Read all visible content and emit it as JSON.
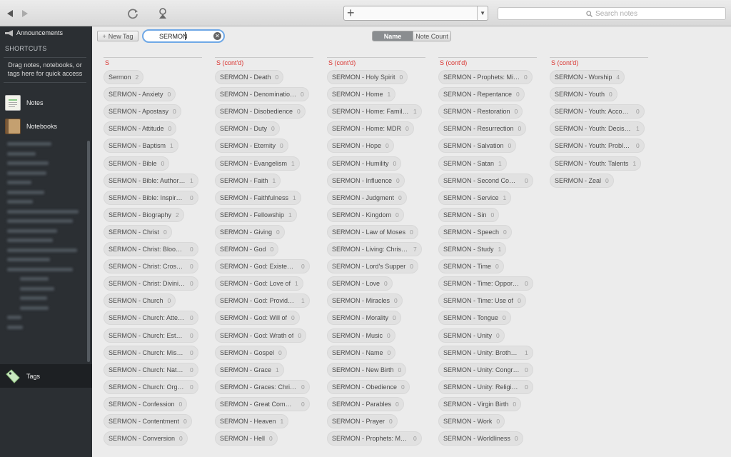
{
  "toolbar": {
    "search_placeholder": "Search notes",
    "new_note_icon": "plus-icon"
  },
  "sidebar": {
    "announcements": "Announcements",
    "shortcuts": "SHORTCUTS",
    "shortcuts_hint": "Drag notes, notebooks, or tags here for quick access",
    "notes": "Notes",
    "notebooks": "Notebooks",
    "tags": "Tags"
  },
  "tags_view": {
    "new_tag_label": "New Tag",
    "filter_value": "SERMON",
    "sort_name": "Name",
    "sort_count": "Note Count",
    "columns": [
      {
        "header": "S",
        "tags": [
          {
            "name": "Sermon",
            "count": "2"
          },
          {
            "name": "SERMON - Anxiety",
            "count": "0"
          },
          {
            "name": "SERMON - Apostasy",
            "count": "0"
          },
          {
            "name": "SERMON - Attitude",
            "count": "0"
          },
          {
            "name": "SERMON - Baptism",
            "count": "1"
          },
          {
            "name": "SERMON - Bible",
            "count": "0"
          },
          {
            "name": "SERMON - Bible: Authori…",
            "count": "1"
          },
          {
            "name": "SERMON - Bible: Inspira…",
            "count": "0"
          },
          {
            "name": "SERMON - Biography",
            "count": "2"
          },
          {
            "name": "SERMON - Christ",
            "count": "0"
          },
          {
            "name": "SERMON - Christ: Blood of",
            "count": "0"
          },
          {
            "name": "SERMON - Christ: Cross of",
            "count": "0"
          },
          {
            "name": "SERMON - Christ: Divinit…",
            "count": "0"
          },
          {
            "name": "SERMON - Church",
            "count": "0"
          },
          {
            "name": "SERMON - Church: Atten…",
            "count": "0"
          },
          {
            "name": "SERMON - Church: Esta…",
            "count": "0"
          },
          {
            "name": "SERMON - Church: Missi…",
            "count": "0"
          },
          {
            "name": "SERMON - Church: Natu…",
            "count": "0"
          },
          {
            "name": "SERMON - Church: Orga…",
            "count": "0"
          },
          {
            "name": "SERMON - Confession",
            "count": "0"
          },
          {
            "name": "SERMON - Contentment",
            "count": "0"
          },
          {
            "name": "SERMON - Conversion",
            "count": "0"
          }
        ]
      },
      {
        "header": "S (cont'd)",
        "tags": [
          {
            "name": "SERMON - Death",
            "count": "0"
          },
          {
            "name": "SERMON - Denominatio…",
            "count": "0"
          },
          {
            "name": "SERMON - Disobedience",
            "count": "0"
          },
          {
            "name": "SERMON - Duty",
            "count": "0"
          },
          {
            "name": "SERMON - Eternity",
            "count": "0"
          },
          {
            "name": "SERMON - Evangelism",
            "count": "1"
          },
          {
            "name": "SERMON - Faith",
            "count": "1"
          },
          {
            "name": "SERMON - Faithfulness",
            "count": "1"
          },
          {
            "name": "SERMON - Fellowship",
            "count": "1"
          },
          {
            "name": "SERMON - Giving",
            "count": "0"
          },
          {
            "name": "SERMON - God",
            "count": "0"
          },
          {
            "name": "SERMON - God: Existen…",
            "count": "0"
          },
          {
            "name": "SERMON - God: Love of",
            "count": "1"
          },
          {
            "name": "SERMON - God: Provide…",
            "count": "1"
          },
          {
            "name": "SERMON - God: Will of",
            "count": "0"
          },
          {
            "name": "SERMON - God: Wrath of",
            "count": "0"
          },
          {
            "name": "SERMON - Gospel",
            "count": "0"
          },
          {
            "name": "SERMON - Grace",
            "count": "1"
          },
          {
            "name": "SERMON - Graces: Chris…",
            "count": "0"
          },
          {
            "name": "SERMON - Great Commi…",
            "count": "0"
          },
          {
            "name": "SERMON - Heaven",
            "count": "1"
          },
          {
            "name": "SERMON - Hell",
            "count": "0"
          }
        ]
      },
      {
        "header": "S (cont'd)",
        "tags": [
          {
            "name": "SERMON - Holy Spirit",
            "count": "0"
          },
          {
            "name": "SERMON - Home",
            "count": "1"
          },
          {
            "name": "SERMON - Home: Family…",
            "count": "1"
          },
          {
            "name": "SERMON - Home: MDR",
            "count": "0"
          },
          {
            "name": "SERMON - Hope",
            "count": "0"
          },
          {
            "name": "SERMON - Humility",
            "count": "0"
          },
          {
            "name": "SERMON - Influence",
            "count": "0"
          },
          {
            "name": "SERMON - Judgment",
            "count": "0"
          },
          {
            "name": "SERMON - Kingdom",
            "count": "0"
          },
          {
            "name": "SERMON - Law of Moses",
            "count": "0"
          },
          {
            "name": "SERMON - Living: Christi…",
            "count": "7"
          },
          {
            "name": "SERMON - Lord's Supper",
            "count": "0"
          },
          {
            "name": "SERMON - Love",
            "count": "0"
          },
          {
            "name": "SERMON - Miracles",
            "count": "0"
          },
          {
            "name": "SERMON - Morality",
            "count": "0"
          },
          {
            "name": "SERMON - Music",
            "count": "0"
          },
          {
            "name": "SERMON - Name",
            "count": "0"
          },
          {
            "name": "SERMON - New Birth",
            "count": "0"
          },
          {
            "name": "SERMON - Obedience",
            "count": "0"
          },
          {
            "name": "SERMON - Parables",
            "count": "0"
          },
          {
            "name": "SERMON - Prayer",
            "count": "0"
          },
          {
            "name": "SERMON - Prophets: Ma…",
            "count": "0"
          }
        ]
      },
      {
        "header": "S (cont'd)",
        "tags": [
          {
            "name": "SERMON - Prophets: Mi…",
            "count": "0"
          },
          {
            "name": "SERMON - Repentance",
            "count": "0"
          },
          {
            "name": "SERMON - Restoration",
            "count": "0"
          },
          {
            "name": "SERMON - Resurrection",
            "count": "0"
          },
          {
            "name": "SERMON - Salvation",
            "count": "0"
          },
          {
            "name": "SERMON - Satan",
            "count": "1"
          },
          {
            "name": "SERMON - Second Comi…",
            "count": "0"
          },
          {
            "name": "SERMON - Service",
            "count": "1"
          },
          {
            "name": "SERMON - Sin",
            "count": "0"
          },
          {
            "name": "SERMON - Speech",
            "count": "0"
          },
          {
            "name": "SERMON - Study",
            "count": "1"
          },
          {
            "name": "SERMON - Time",
            "count": "0"
          },
          {
            "name": "SERMON - Time: Opport…",
            "count": "0"
          },
          {
            "name": "SERMON - Time: Use of",
            "count": "0"
          },
          {
            "name": "SERMON - Tongue",
            "count": "0"
          },
          {
            "name": "SERMON - Unity",
            "count": "0"
          },
          {
            "name": "SERMON - Unity: Brothe…",
            "count": "1"
          },
          {
            "name": "SERMON - Unity: Congre…",
            "count": "0"
          },
          {
            "name": "SERMON - Unity: Religio…",
            "count": "0"
          },
          {
            "name": "SERMON - Virgin Birth",
            "count": "0"
          },
          {
            "name": "SERMON - Work",
            "count": "0"
          },
          {
            "name": "SERMON - Worldliness",
            "count": "0"
          }
        ]
      },
      {
        "header": "S (cont'd)",
        "tags": [
          {
            "name": "SERMON - Worship",
            "count": "4"
          },
          {
            "name": "SERMON - Youth",
            "count": "0"
          },
          {
            "name": "SERMON - Youth: Accou…",
            "count": "0"
          },
          {
            "name": "SERMON - Youth: Decisi…",
            "count": "1"
          },
          {
            "name": "SERMON - Youth: Proble…",
            "count": "0"
          },
          {
            "name": "SERMON - Youth: Talents",
            "count": "1"
          },
          {
            "name": "SERMON - Zeal",
            "count": "0"
          }
        ]
      }
    ]
  }
}
